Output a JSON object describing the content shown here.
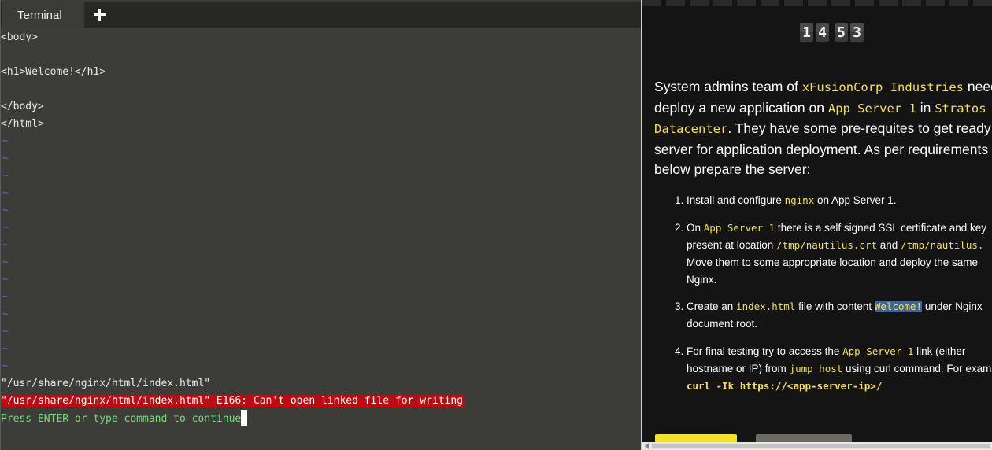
{
  "terminal": {
    "tab_label": "Terminal",
    "add_tab_icon": "plus-icon",
    "lines": [
      "<body>",
      "",
      "<h1>Welcome!</h1>",
      "",
      "</body>",
      "</html>"
    ],
    "tilde": "~",
    "tilde_count": 14,
    "status_file": "\"/usr/share/nginx/html/index.html\"",
    "status_error": "\"/usr/share/nginx/html/index.html\" E166: Can't open linked file for writing",
    "status_press": "Press ENTER or type command to continue",
    "colors": {
      "background": "#3c3c38",
      "tilde": "#5a69d6",
      "error_bg": "#c00a12",
      "press_text": "#6de46f"
    }
  },
  "instructions": {
    "timer_digits": [
      "1",
      "4",
      "5",
      "3"
    ],
    "intro": {
      "p1": "System admins team of ",
      "company": "xFusionCorp Industries",
      "p2": " needs",
      "p3": "deploy a new application on ",
      "server": "App Server 1",
      "p4": " in ",
      "datacenter_a": "Stratos",
      "datacenter_b": "Datacenter",
      "p5": ". They have some pre-requites to get ready th",
      "p6": "server for application deployment. As per requirements sh",
      "p7": "below prepare the server:"
    },
    "tasks": [
      {
        "num": "1.",
        "a": "Install and configure ",
        "code1": "nginx",
        "b": " on App Server 1."
      },
      {
        "num": "2.",
        "a": "On ",
        "code1": "App Server 1",
        "b": " there is a self signed SSL certificate and key",
        "c": "present at location ",
        "code2": "/tmp/nautilus.crt",
        "d": " and ",
        "code3": "/tmp/nautilus.",
        "e": "Move them to some appropriate location and deploy the same",
        "f": "Nginx."
      },
      {
        "num": "3.",
        "a": "Create an ",
        "code1": "index.html",
        "b": " file with content ",
        "code2": "Welcome!",
        "c": " under Nginx",
        "d": "document root."
      },
      {
        "num": "4.",
        "a": "For final testing try to access the ",
        "code1": "App Server 1",
        "b": " link (either",
        "c": "hostname or IP) from ",
        "code2": "jump host",
        "d": " using curl command. For exam",
        "code3": "curl -Ik https://<app-server-ip>/"
      }
    ],
    "colors": {
      "background": "#141414",
      "code": "#f4e04d",
      "highlight": "#44648c",
      "primary_button": "#f3e21f",
      "secondary_button": "#6c6a62"
    }
  }
}
